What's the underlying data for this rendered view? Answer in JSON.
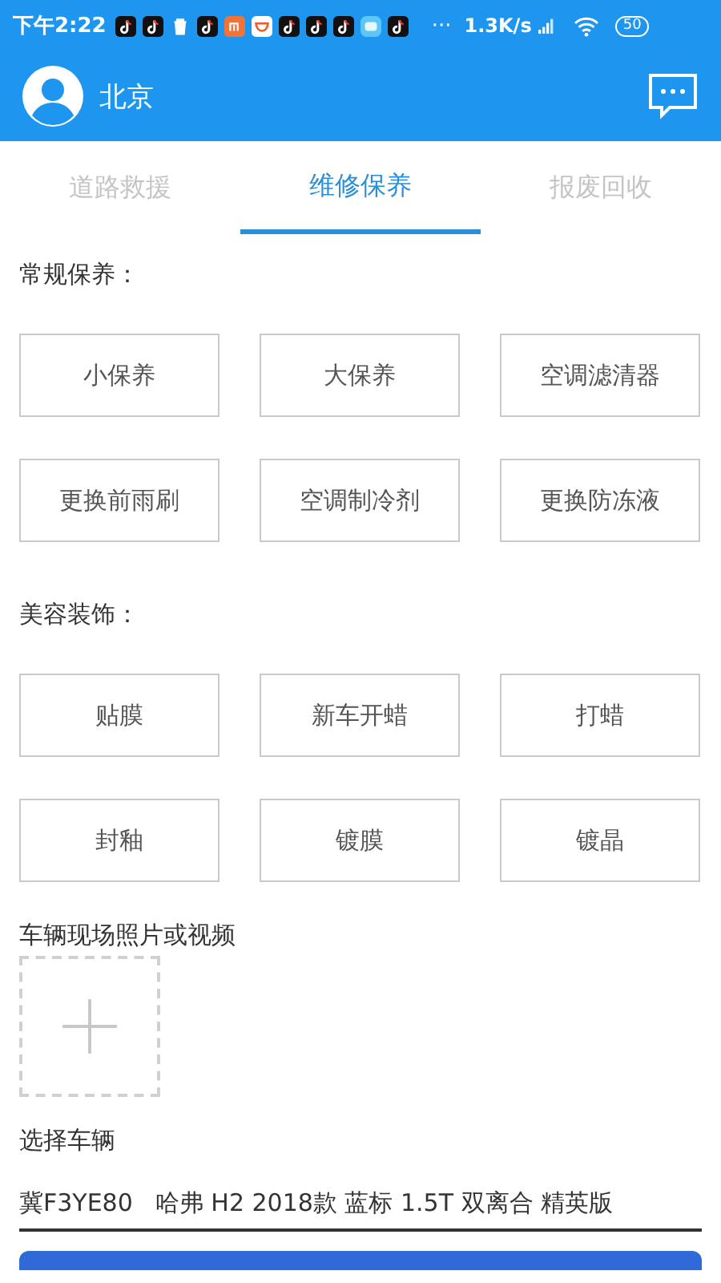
{
  "status_bar": {
    "time": "下午2:22",
    "more": "···",
    "speed": "1.3K/s",
    "battery": "50"
  },
  "header": {
    "city": "北京"
  },
  "tabs": [
    {
      "label": "道路救援",
      "selected": false
    },
    {
      "label": "维修保养",
      "selected": true
    },
    {
      "label": "报废回收",
      "selected": false
    }
  ],
  "sections": [
    {
      "title": "常规保养：",
      "options": [
        "小保养",
        "大保养",
        "空调滤清器",
        "更换前雨刷",
        "空调制冷剂",
        "更换防冻液"
      ]
    },
    {
      "title": "美容装饰：",
      "options": [
        "贴膜",
        "新车开蜡",
        "打蜡",
        "封釉",
        "镀膜",
        "镀晶"
      ]
    }
  ],
  "media": {
    "title": "车辆现场照片或视频"
  },
  "vehicle": {
    "title": "选择车辆",
    "plate": "冀F3YE80",
    "model": "哈弗 H2 2018款 蓝标 1.5T 双离合 精英版"
  }
}
